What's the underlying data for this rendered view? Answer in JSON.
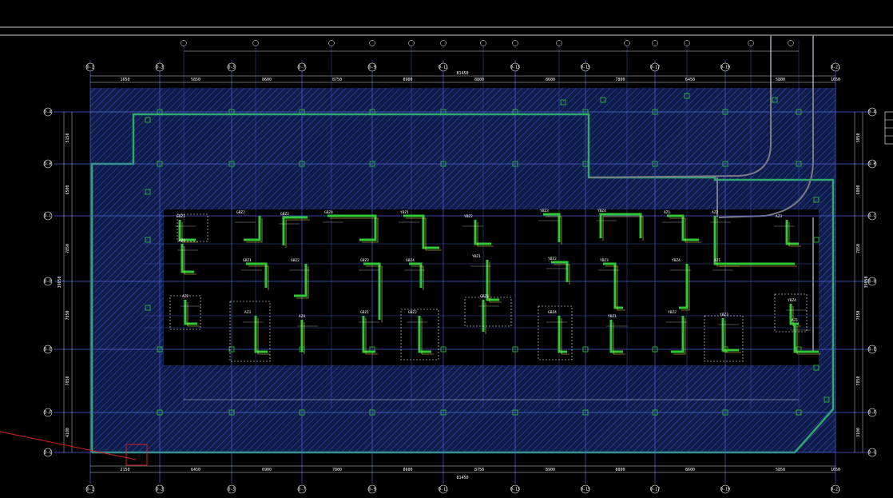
{
  "colors": {
    "background": "#000000",
    "grid_line": "#4a63d8",
    "hatch": "#3a55c8",
    "hatch_fill": "#101c4a",
    "outline": "#2fa870",
    "wall": "#32c83a",
    "wall_cut": "#e6d84a",
    "dimension": "#ffffff",
    "pipe": "#7a7a86",
    "marker": "#d02020"
  },
  "grid_bubbles_top": [
    "D-1",
    "D-3",
    "D-5",
    "D-7",
    "D-9",
    "D-11",
    "D-13",
    "D-15",
    "D-17",
    "D-19",
    "D-21"
  ],
  "grid_bubbles_bottom": [
    "D-1",
    "D-3",
    "D-5",
    "D-7",
    "D-9",
    "D-11",
    "D-13",
    "D-15",
    "D-17",
    "D-19",
    "D-21"
  ],
  "grid_bubbles_left": [
    "D-A",
    "D-B",
    "D-C",
    "D-D",
    "D-E",
    "D-F",
    "D-G"
  ],
  "grid_bubbles_right": [
    "D-A",
    "D-B",
    "D-C",
    "D-D",
    "D-E",
    "D-F",
    "D-G"
  ],
  "dims_top": [
    "1650",
    "5850",
    "8600",
    "8750",
    "8900",
    "8800",
    "8600",
    "7800",
    "6450",
    "5800",
    "1650"
  ],
  "dims_bottom": [
    "2150",
    "6450",
    "6900",
    "7800",
    "8600",
    "8750",
    "8900",
    "8800",
    "8600",
    "5850",
    "1650"
  ],
  "dims_left": [
    "5150",
    "6500",
    "7850",
    "7850",
    "7850",
    "4100"
  ],
  "dims_right": [
    "3050",
    "6800",
    "7850",
    "7850",
    "7850",
    "3100"
  ],
  "total_top": "81450",
  "total_bottom": "81450",
  "total_left": "39050",
  "total_right": "39050",
  "wall_tags": [
    "GBZ1",
    "GBZ2",
    "GBZ3",
    "GBZ4",
    "YBZ1",
    "YBZ2",
    "YBZ3",
    "YBZ4",
    "AZ1",
    "AZ2",
    "AZ3",
    "AZ4"
  ]
}
